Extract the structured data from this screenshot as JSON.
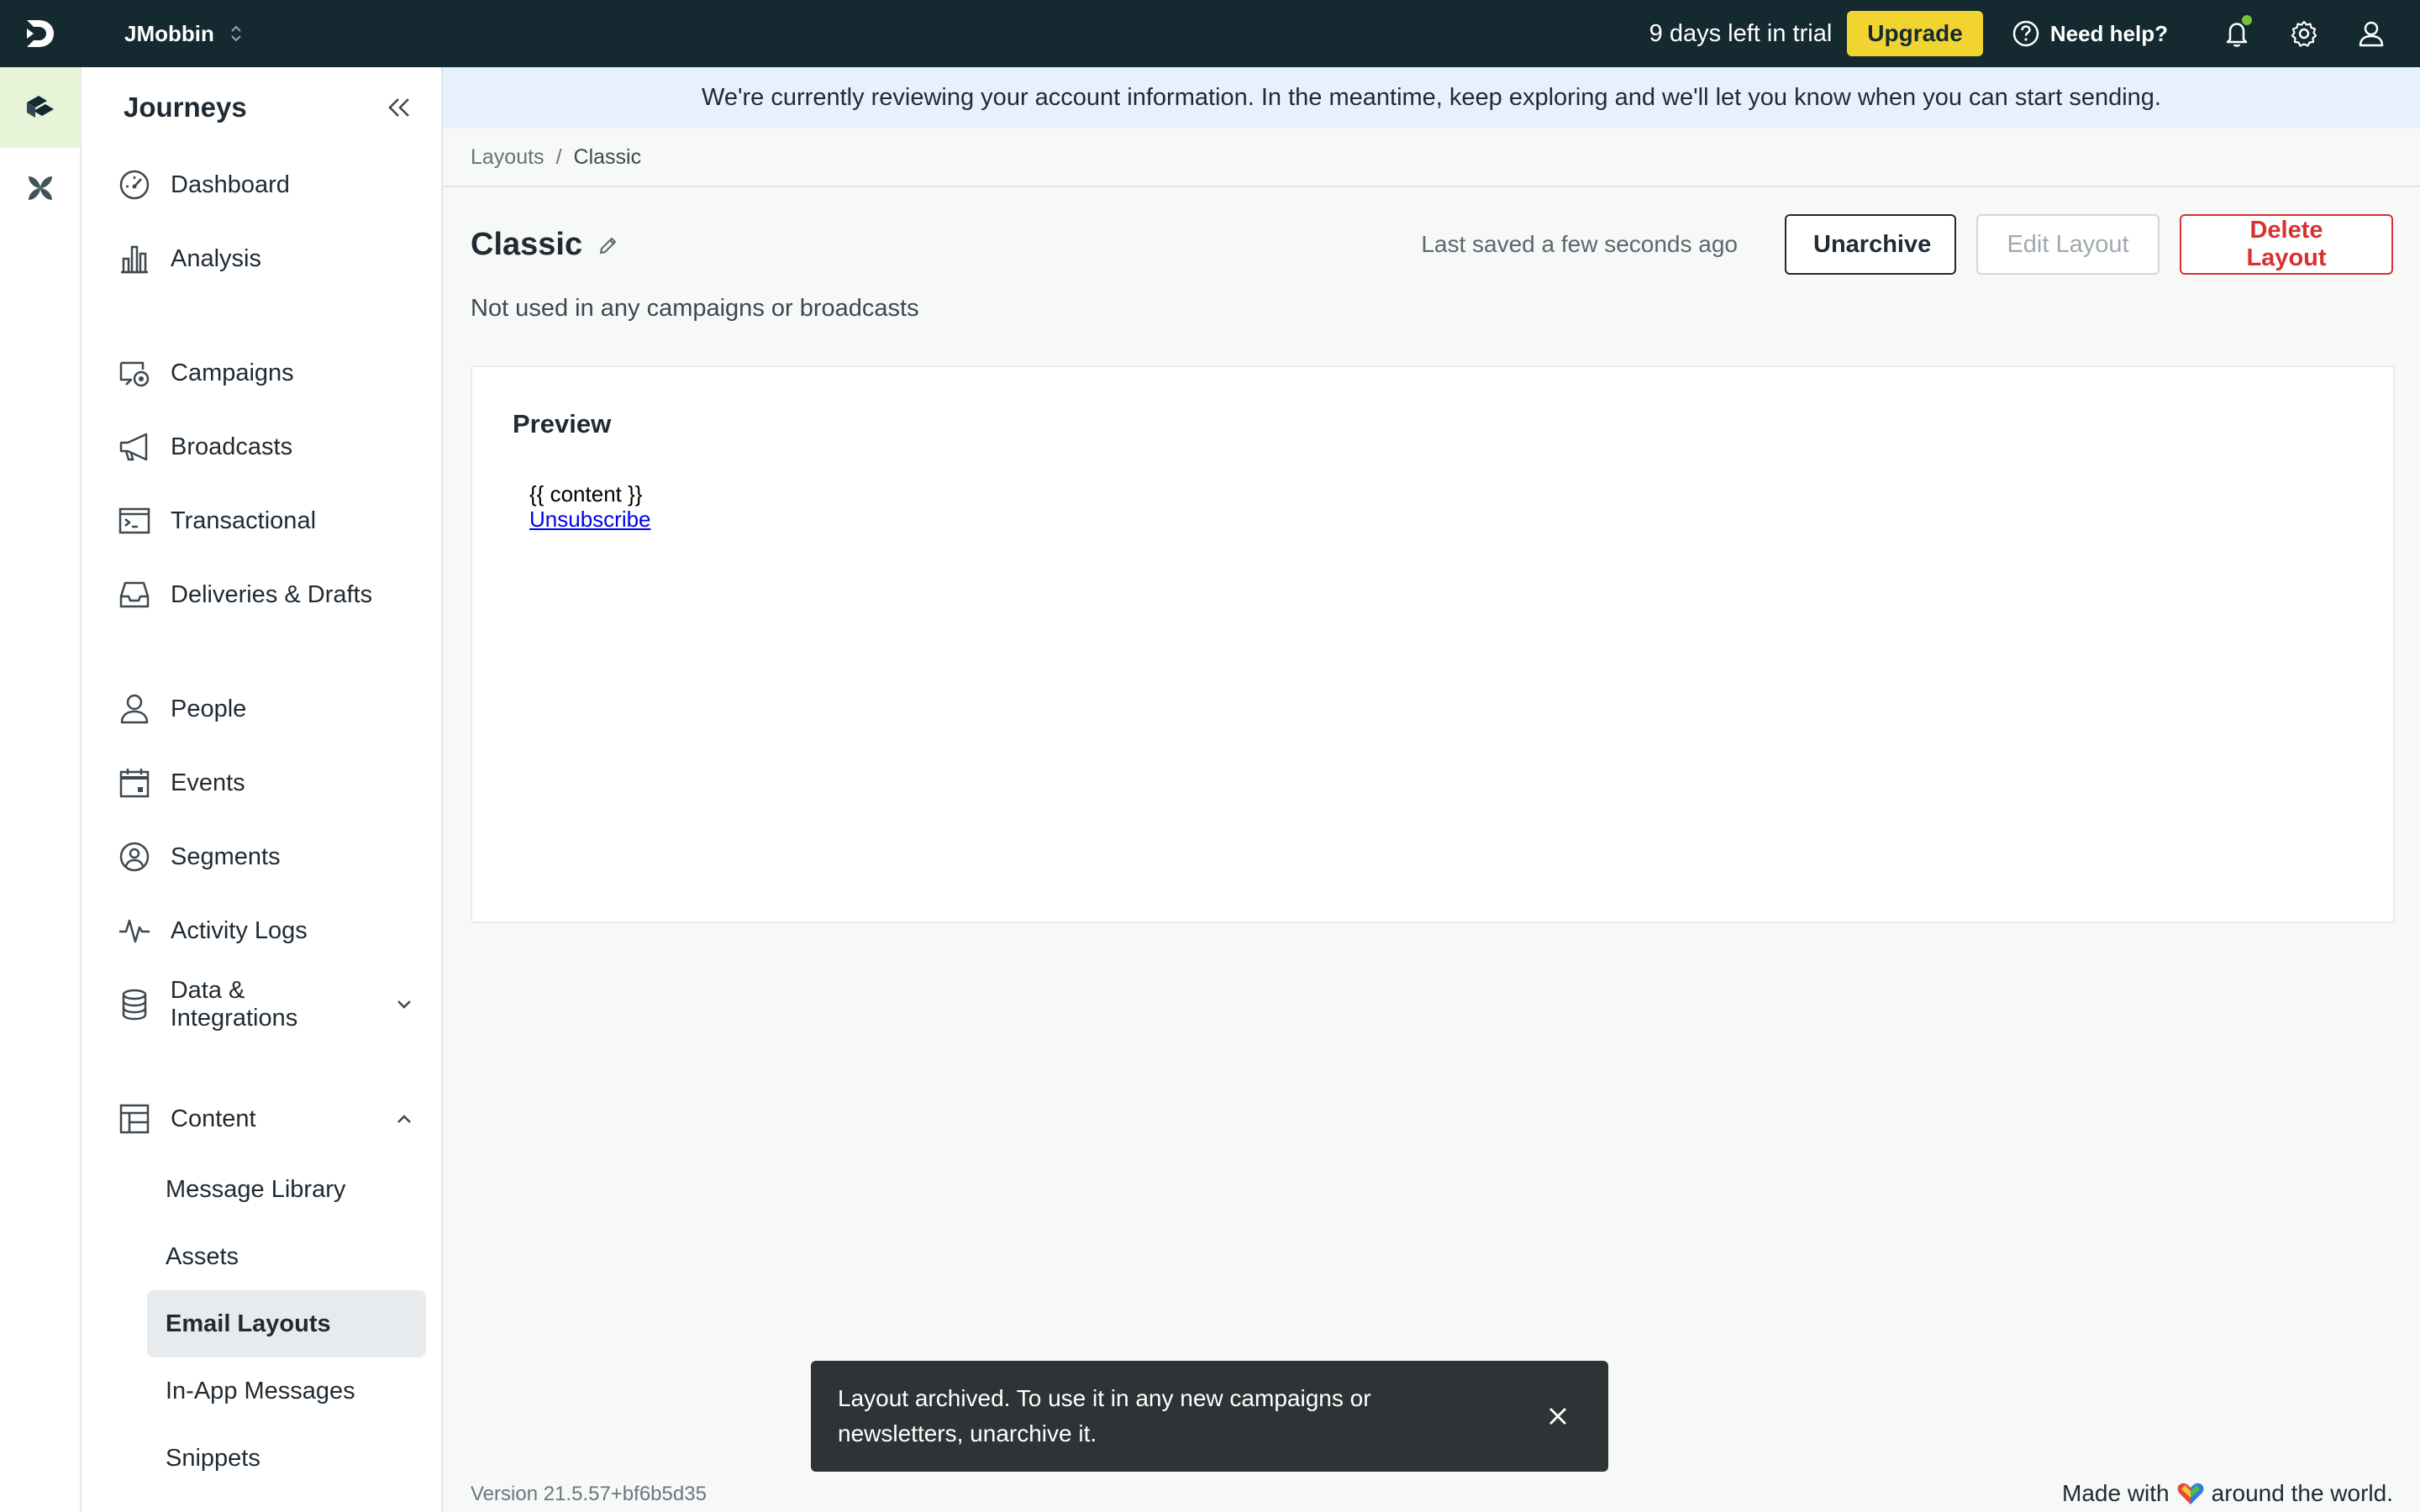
{
  "topbar": {
    "workspace": "JMobbin",
    "trial_text": "9 days left in trial",
    "upgrade_label": "Upgrade",
    "help_label": "Need help?"
  },
  "sidebar": {
    "title": "Journeys",
    "items": [
      {
        "label": "Dashboard",
        "icon": "dashboard-gauge-icon"
      },
      {
        "label": "Analysis",
        "icon": "bar-chart-icon"
      },
      {
        "label": "Campaigns",
        "icon": "campaigns-icon"
      },
      {
        "label": "Broadcasts",
        "icon": "megaphone-icon"
      },
      {
        "label": "Transactional",
        "icon": "terminal-icon"
      },
      {
        "label": "Deliveries & Drafts",
        "icon": "inbox-icon"
      },
      {
        "label": "People",
        "icon": "person-icon"
      },
      {
        "label": "Events",
        "icon": "calendar-icon"
      },
      {
        "label": "Segments",
        "icon": "segment-icon"
      },
      {
        "label": "Activity Logs",
        "icon": "pulse-icon"
      },
      {
        "label": "Data & Integrations",
        "icon": "database-icon"
      },
      {
        "label": "Content",
        "icon": "layout-icon"
      }
    ],
    "content_sub": [
      "Message Library",
      "Assets",
      "Email Layouts",
      "In-App Messages",
      "Snippets"
    ]
  },
  "banner": "We're currently reviewing your account information. In the meantime, keep exploring and we'll let you know when you can start sending.",
  "breadcrumb": {
    "parent": "Layouts",
    "sep": "/",
    "current": "Classic"
  },
  "page": {
    "title": "Classic",
    "saved": "Last saved a few seconds ago",
    "unarchive": "Unarchive",
    "edit": "Edit Layout",
    "delete": "Delete Layout",
    "usage": "Not used in any campaigns or broadcasts"
  },
  "preview": {
    "title": "Preview",
    "content": "{{ content }}",
    "unsubscribe": "Unsubscribe"
  },
  "toast": {
    "message": "Layout archived. To use it in any new campaigns or newsletters, unarchive it."
  },
  "footer": {
    "version": "Version 21.5.57+bf6b5d35",
    "made_prefix": "Made with",
    "made_suffix": "around the world."
  },
  "colors": {
    "topbar": "#142a30",
    "upgrade": "#f2d431",
    "danger": "#d7322f",
    "banner": "#e7f1fb",
    "active_rail": "#e6f4d8"
  }
}
